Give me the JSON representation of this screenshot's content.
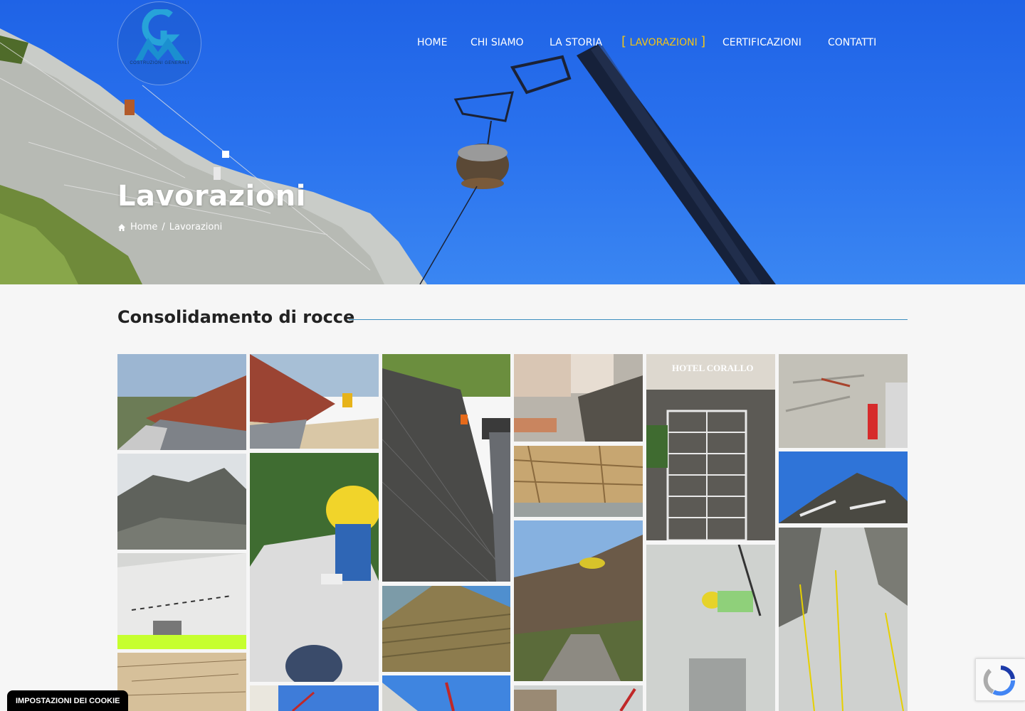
{
  "logo": {
    "sub_text": "COSTRUZIONI GENERALI"
  },
  "nav": {
    "items": [
      {
        "label": "HOME",
        "active": false
      },
      {
        "label": "CHI SIAMO",
        "active": false
      },
      {
        "label": "LA STORIA",
        "active": false
      },
      {
        "label": "LAVORAZIONI",
        "active": true
      },
      {
        "label": "CERTIFICAZIONI",
        "active": false
      },
      {
        "label": "CONTATTI",
        "active": false
      }
    ],
    "active_bracket_open": "[",
    "active_bracket_close": "]"
  },
  "hero": {
    "title": "Lavorazioni",
    "breadcrumb": {
      "home": "Home",
      "separator": "/",
      "current": "Lavorazioni"
    }
  },
  "section": {
    "title": "Consolidamento di rocce"
  },
  "gallery": {
    "hotel_sign": "HOTEL CORALLO"
  },
  "cookie": {
    "label": "IMPOSTAZIONI DEI COOKIE"
  },
  "colors": {
    "accent": "#f0c419",
    "line": "#3d8fc0",
    "sky": "#2a72ee"
  }
}
